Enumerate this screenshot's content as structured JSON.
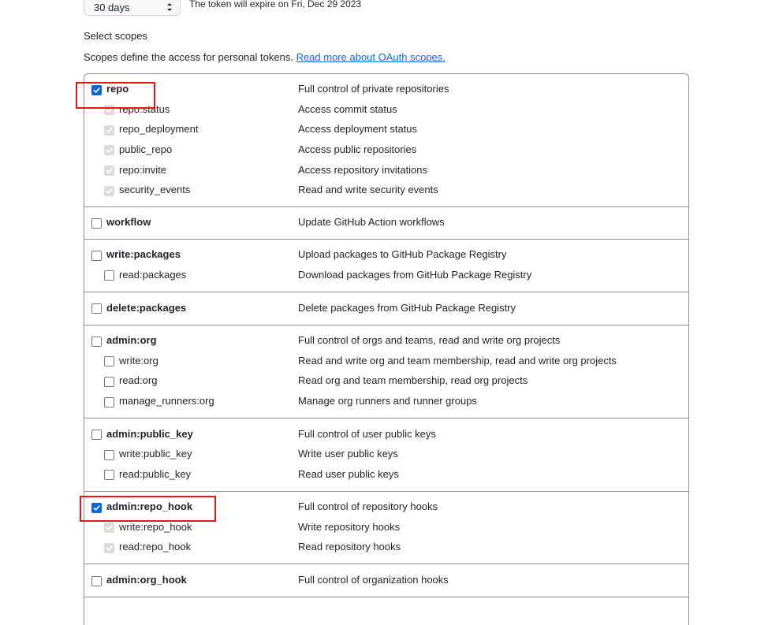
{
  "expiration": {
    "selected": "30 days",
    "note": "The token will expire on Fri, Dec 29 2023"
  },
  "scopes_section": {
    "heading": "Select scopes",
    "intro": "Scopes define the access for personal tokens.",
    "link": "Read more about OAuth scopes."
  },
  "colors": {
    "checked": "#0a66d6",
    "link": "#0969da",
    "highlight": "#e0181b",
    "border": "#8c959f"
  },
  "groups": [
    {
      "name": "repo",
      "desc": "Full control of private repositories",
      "checked": true,
      "children": [
        {
          "name": "repo:status",
          "desc": "Access commit status"
        },
        {
          "name": "repo_deployment",
          "desc": "Access deployment status"
        },
        {
          "name": "public_repo",
          "desc": "Access public repositories"
        },
        {
          "name": "repo:invite",
          "desc": "Access repository invitations"
        },
        {
          "name": "security_events",
          "desc": "Read and write security events"
        }
      ]
    },
    {
      "name": "workflow",
      "desc": "Update GitHub Action workflows",
      "checked": false,
      "children": []
    },
    {
      "name": "write:packages",
      "desc": "Upload packages to GitHub Package Registry",
      "checked": false,
      "children": [
        {
          "name": "read:packages",
          "desc": "Download packages from GitHub Package Registry"
        }
      ]
    },
    {
      "name": "delete:packages",
      "desc": "Delete packages from GitHub Package Registry",
      "checked": false,
      "children": []
    },
    {
      "name": "admin:org",
      "desc": "Full control of orgs and teams, read and write org projects",
      "checked": false,
      "children": [
        {
          "name": "write:org",
          "desc": "Read and write org and team membership, read and write org projects"
        },
        {
          "name": "read:org",
          "desc": "Read org and team membership, read org projects"
        },
        {
          "name": "manage_runners:org",
          "desc": "Manage org runners and runner groups"
        }
      ]
    },
    {
      "name": "admin:public_key",
      "desc": "Full control of user public keys",
      "checked": false,
      "children": [
        {
          "name": "write:public_key",
          "desc": "Write user public keys"
        },
        {
          "name": "read:public_key",
          "desc": "Read user public keys"
        }
      ]
    },
    {
      "name": "admin:repo_hook",
      "desc": "Full control of repository hooks",
      "checked": true,
      "children": [
        {
          "name": "write:repo_hook",
          "desc": "Write repository hooks"
        },
        {
          "name": "read:repo_hook",
          "desc": "Read repository hooks"
        }
      ]
    },
    {
      "name": "admin:org_hook",
      "desc": "Full control of organization hooks",
      "checked": false,
      "children": []
    }
  ]
}
